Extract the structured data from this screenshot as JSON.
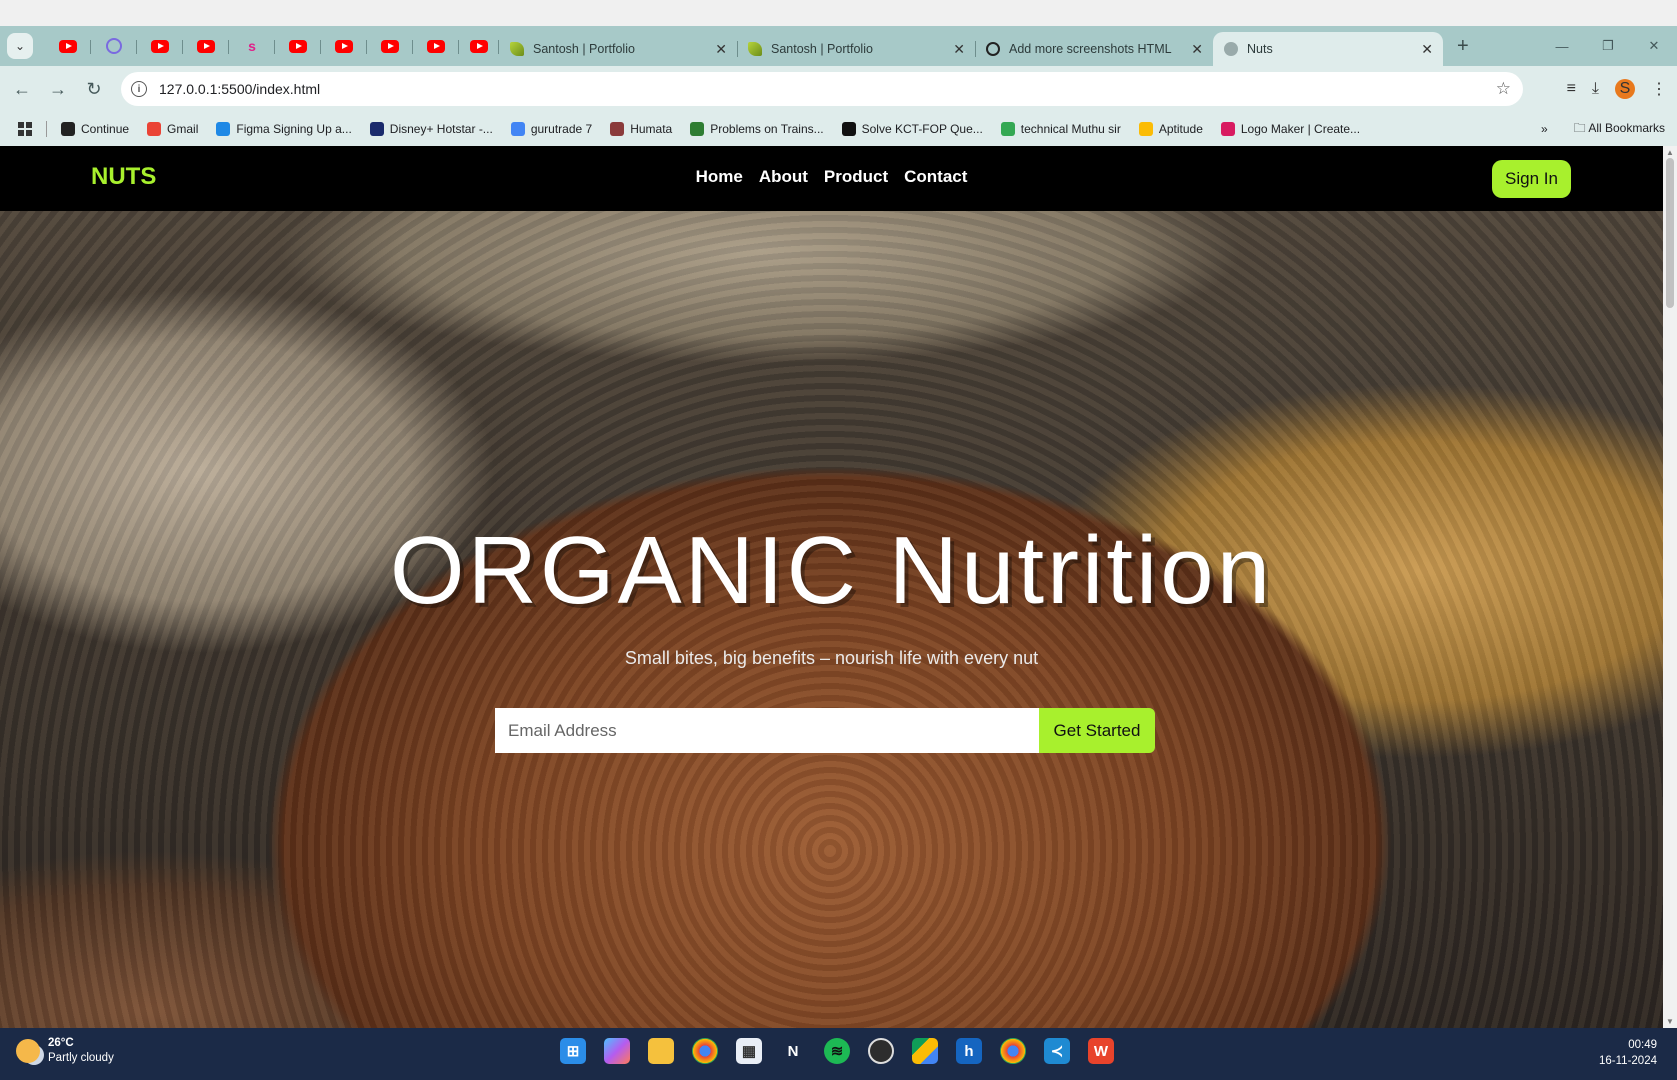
{
  "browser": {
    "tabs": [
      {
        "title": "Santosh | Portfolio",
        "icon": "leaf-icon"
      },
      {
        "title": "Santosh | Portfolio",
        "icon": "leaf-icon"
      },
      {
        "title": "Add more screenshots HTML",
        "icon": "chatgpt-icon"
      },
      {
        "title": "Nuts",
        "icon": "globe-icon",
        "active": true
      }
    ],
    "url": "127.0.0.1:5500/index.html",
    "profile_initial": "S",
    "bookmarks": [
      {
        "label": "Continue",
        "color": "#222222"
      },
      {
        "label": "Gmail",
        "color": "#ea4335"
      },
      {
        "label": "Figma Signing Up a...",
        "color": "#1e88e5"
      },
      {
        "label": "Disney+ Hotstar -...",
        "color": "#1a2a6c"
      },
      {
        "label": "gurutrade 7",
        "color": "#4285f4"
      },
      {
        "label": "Humata",
        "color": "#8a3b3b"
      },
      {
        "label": "Problems on Trains...",
        "color": "#2e7d32"
      },
      {
        "label": "Solve KCT-FOP Que...",
        "color": "#111111"
      },
      {
        "label": "technical Muthu sir",
        "color": "#34a853"
      },
      {
        "label": "Aptitude",
        "color": "#fbbc05"
      },
      {
        "label": "Logo Maker | Create...",
        "color": "#d81b60"
      }
    ],
    "all_bookmarks": "All Bookmarks"
  },
  "site": {
    "logo": "NUTS",
    "nav": [
      "Home",
      "About",
      "Product",
      "Contact"
    ],
    "signin": "Sign In",
    "hero_title": "ORGANIC Nutrition",
    "hero_subtitle": "Small bites, big benefits – nourish life with every nut",
    "email_placeholder": "Email Address",
    "cta": "Get Started",
    "colors": {
      "accent": "#a8f02d",
      "nav_bg": "#000000"
    }
  },
  "taskbar": {
    "temperature": "26°C",
    "condition": "Partly cloudy",
    "time": "00:49",
    "date": "16-11-2024"
  }
}
